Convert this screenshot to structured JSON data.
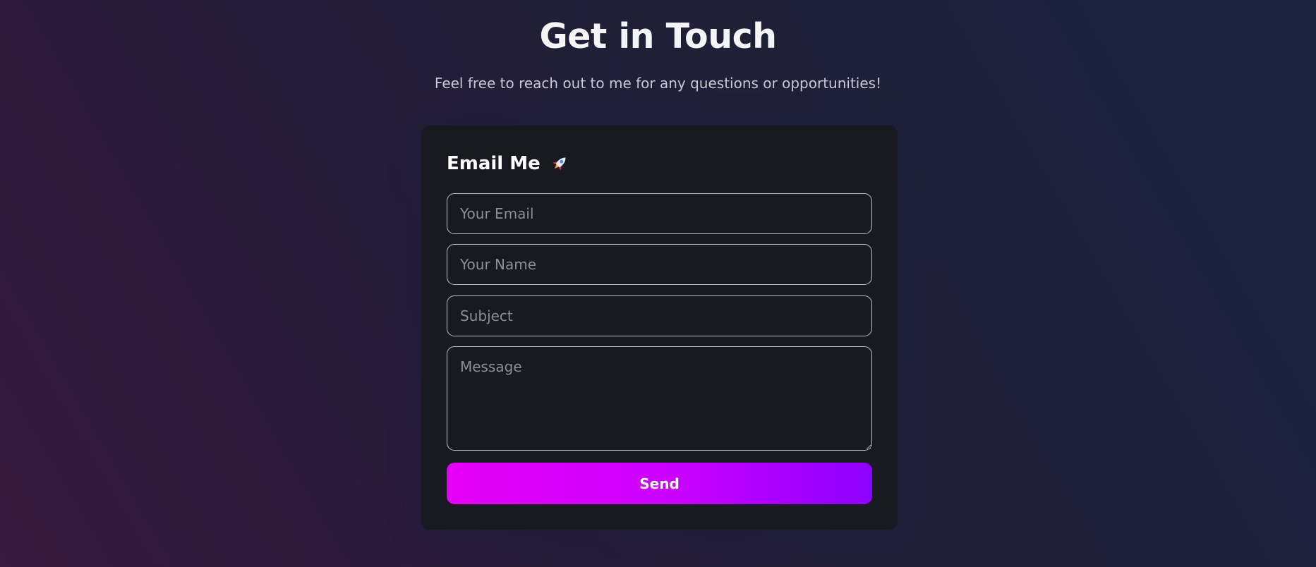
{
  "header": {
    "title": "Get in Touch",
    "subtitle": "Feel free to reach out to me for any questions or opportunities!"
  },
  "form": {
    "title": "Email Me",
    "title_icon": "rocket-icon",
    "email_placeholder": "Your Email",
    "name_placeholder": "Your Name",
    "subject_placeholder": "Subject",
    "message_placeholder": "Message",
    "email_value": "",
    "name_value": "",
    "subject_value": "",
    "message_value": "",
    "send_label": "Send"
  },
  "colors": {
    "accent_start": "#e600f5",
    "accent_end": "#8c00ff",
    "card_background": "#191921"
  }
}
